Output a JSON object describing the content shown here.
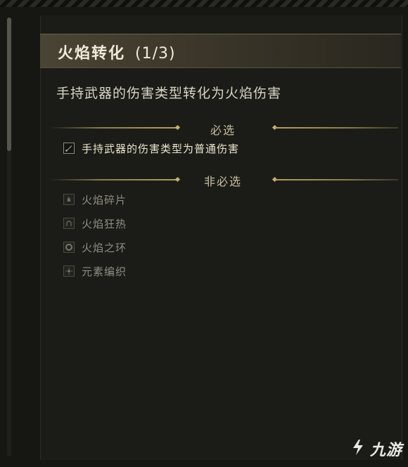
{
  "title": {
    "name": "火焰转化",
    "count": "(1/3)"
  },
  "description": "手持武器的伤害类型转化为火焰伤害",
  "required_section": {
    "label": "必选",
    "items": [
      {
        "label": "手持武器的伤害类型为普通伤害",
        "icon": "weapon-icon"
      }
    ]
  },
  "optional_section": {
    "label": "非必选",
    "items": [
      {
        "label": "火焰碎片",
        "icon": "fire-shard-icon"
      },
      {
        "label": "火焰狂热",
        "icon": "fire-frenzy-icon"
      },
      {
        "label": "火焰之环",
        "icon": "fire-ring-icon"
      },
      {
        "label": "元素编织",
        "icon": "element-weave-icon"
      }
    ]
  },
  "watermark": {
    "text": "九游",
    "icon": "jiuyou-logo-icon"
  },
  "colors": {
    "background": "#161712",
    "title_bar": "#3b3629",
    "accent_gold": "#b49d60",
    "text_primary": "#ece6cf",
    "text_muted": "#8f8d84"
  }
}
